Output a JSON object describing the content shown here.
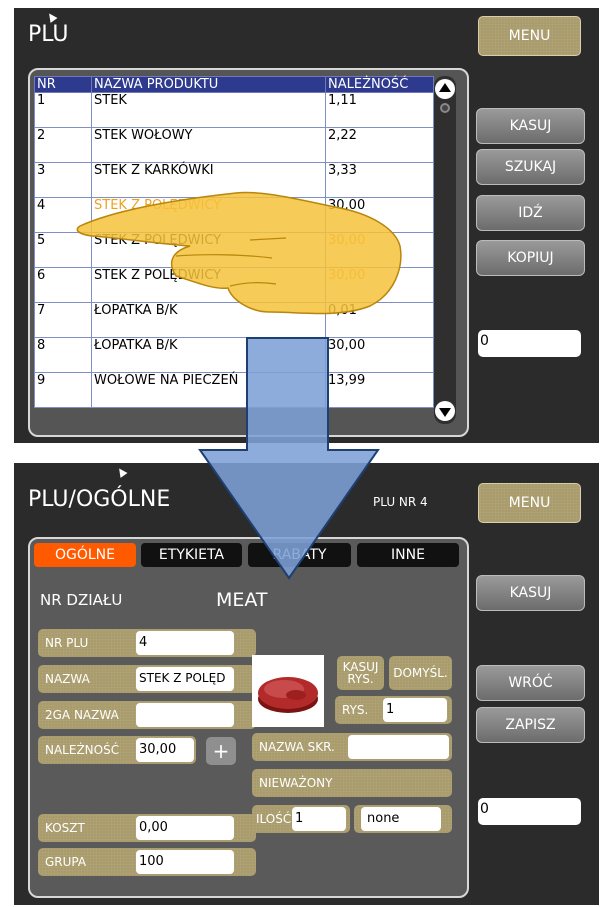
{
  "top_screen": {
    "title": "PLU",
    "menu_label": "MENU",
    "table": {
      "headers": [
        "NR",
        "NAZWA PRODUKTU",
        "NALEŻNOŚĆ"
      ],
      "rows": [
        [
          "1",
          "STEK",
          "1,11"
        ],
        [
          "2",
          "STEK WOŁOWY",
          "2,22"
        ],
        [
          "3",
          "STEK Z KARKÓWKI",
          "3,33"
        ],
        [
          "4",
          "STEK Z POLĘDWICY",
          "30,00"
        ],
        [
          "5",
          "STEK Z POLĘDWICY",
          "30,00"
        ],
        [
          "6",
          "STEK Z POLĘDWICY",
          "30,00"
        ],
        [
          "7",
          "ŁOPATKA B/K",
          "0,01"
        ],
        [
          "8",
          "ŁOPATKA B/K",
          "30,00"
        ],
        [
          "9",
          "WOŁOWE NA PIECZEŃ",
          "13,99"
        ]
      ],
      "highlight_color": "#f0a020"
    },
    "buttons": {
      "kasuj": "KASUJ",
      "szukaj": "SZUKAJ",
      "idz": "IDŹ",
      "kopiuj": "KOPIUJ"
    },
    "field_value": "0"
  },
  "bottom_screen": {
    "title": "PLU/OGÓLNE",
    "plu_nr": "PLU NR 4",
    "menu_label": "MENU",
    "tabs": [
      "OGÓLNE",
      "ETYKIETA",
      "RABATY",
      "INNE"
    ],
    "active_tab": "OGÓLNE",
    "dept_label": "NR DZIAŁU",
    "dept_value": "MEAT",
    "fields": {
      "nr_plu": {
        "label": "NR PLU",
        "value": "4"
      },
      "nazwa": {
        "label": "NAZWA",
        "value": "STEK Z POLĘD"
      },
      "nazwa2": {
        "label": "2GA NAZWA",
        "value": ""
      },
      "naleznosc": {
        "label": "NALEŻNOŚĆ",
        "value": "30,00"
      },
      "koszt": {
        "label": "KOSZT",
        "value": "0,00"
      },
      "grupa": {
        "label": "GRUPA",
        "value": "100"
      },
      "nazwa_skr": {
        "label": "NAZWA SKR.",
        "value": ""
      },
      "niewazony": {
        "label": "NIEWAŻONY"
      },
      "ilosc": {
        "label": "ILOŚĆ",
        "value": "1"
      },
      "unit": {
        "value": "none"
      },
      "rys": {
        "label": "RYS.",
        "value": "1"
      },
      "kasuj_rys": {
        "label": "KASUJ RYS."
      },
      "domysl": {
        "label": "DOMYŚL."
      }
    },
    "plus_label": "+",
    "buttons": {
      "kasuj": "KASUJ",
      "wroc": "WRÓĆ",
      "zapisz": "ZAPISZ"
    },
    "field_value": "0"
  }
}
